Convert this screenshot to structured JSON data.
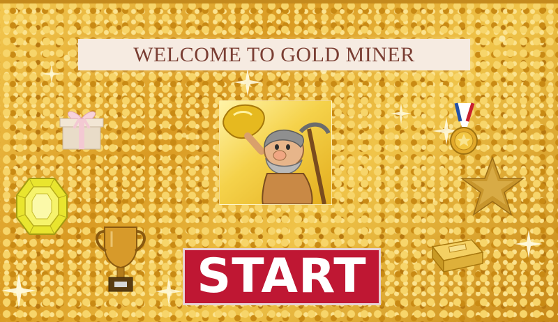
{
  "banner": {
    "title": "WELCOME TO GOLD MINER"
  },
  "start_button": {
    "label": "START",
    "color": "#bf1733"
  },
  "decorations": [
    "gift-box-icon",
    "medal-icon",
    "gem-icon",
    "star-icon",
    "trophy-icon",
    "gold-bar-icon"
  ],
  "colors": {
    "background": "#e2a72c",
    "banner_background": "#f6ebe1",
    "banner_text": "#7a3e33"
  }
}
